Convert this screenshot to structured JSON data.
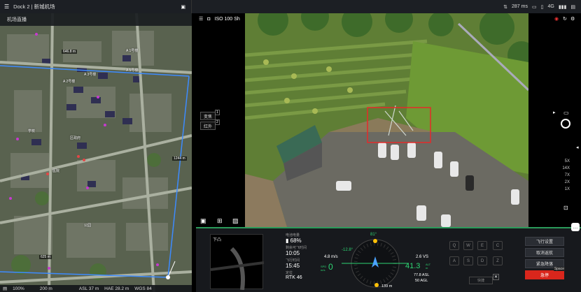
{
  "topbar": {
    "title": "Dock 2 | 新城机场",
    "latency": "287 ms",
    "signal": "4G"
  },
  "map": {
    "header": "机场直播",
    "dist_top": "646.8 m",
    "dist_mid": "1244 m",
    "dist_bottom": "625 m",
    "labels": [
      "A 3号楼",
      "A 1号楼",
      "A 2号楼",
      "A 5号楼",
      "区政府",
      "学校",
      "医院",
      "公园"
    ],
    "footer": {
      "zoom": "100%",
      "scale": "200 m",
      "asl": "ASL 37 m",
      "hae": "HAE 28.2 m",
      "crs": "WGS 84"
    }
  },
  "camera": {
    "iso": "ISO 100",
    "shutter": "Sh",
    "mode_visible": "变焦",
    "mode_ir": "红外",
    "zoom_levels": [
      "5X",
      "14X",
      "7X",
      "2X",
      "1X"
    ]
  },
  "dashboard": {
    "preview_label": "下凸",
    "battery_label": "电池电量",
    "battery": "68%",
    "remaining_label": "剩余可飞时间",
    "remaining": "10:05",
    "flight_time_label": "飞行时间",
    "flight_time": "15:45",
    "rtk_label": "定位",
    "rtk": "RTK 46",
    "wind_speed": "4.8 m/s",
    "hspeed_label": "SPD m/s",
    "hspeed": "0",
    "vspeed": "2.6 VS",
    "pitch": "-12.8°",
    "heading": "81°",
    "altitude": "41.3",
    "alt_unit": "ALT m",
    "asl": "77.8 ASL",
    "agl": "50 AGL",
    "dist_home": "139 m",
    "keys": [
      "Q",
      "W",
      "E",
      "C",
      "A",
      "S",
      "D",
      "Z"
    ],
    "key_hint": "快捷",
    "buttons": {
      "flight_settings": "飞行设置",
      "cancel_return": "取消返航",
      "emergency_land": "紧急降落",
      "stop": "急停",
      "stop_key": "Space"
    }
  }
}
